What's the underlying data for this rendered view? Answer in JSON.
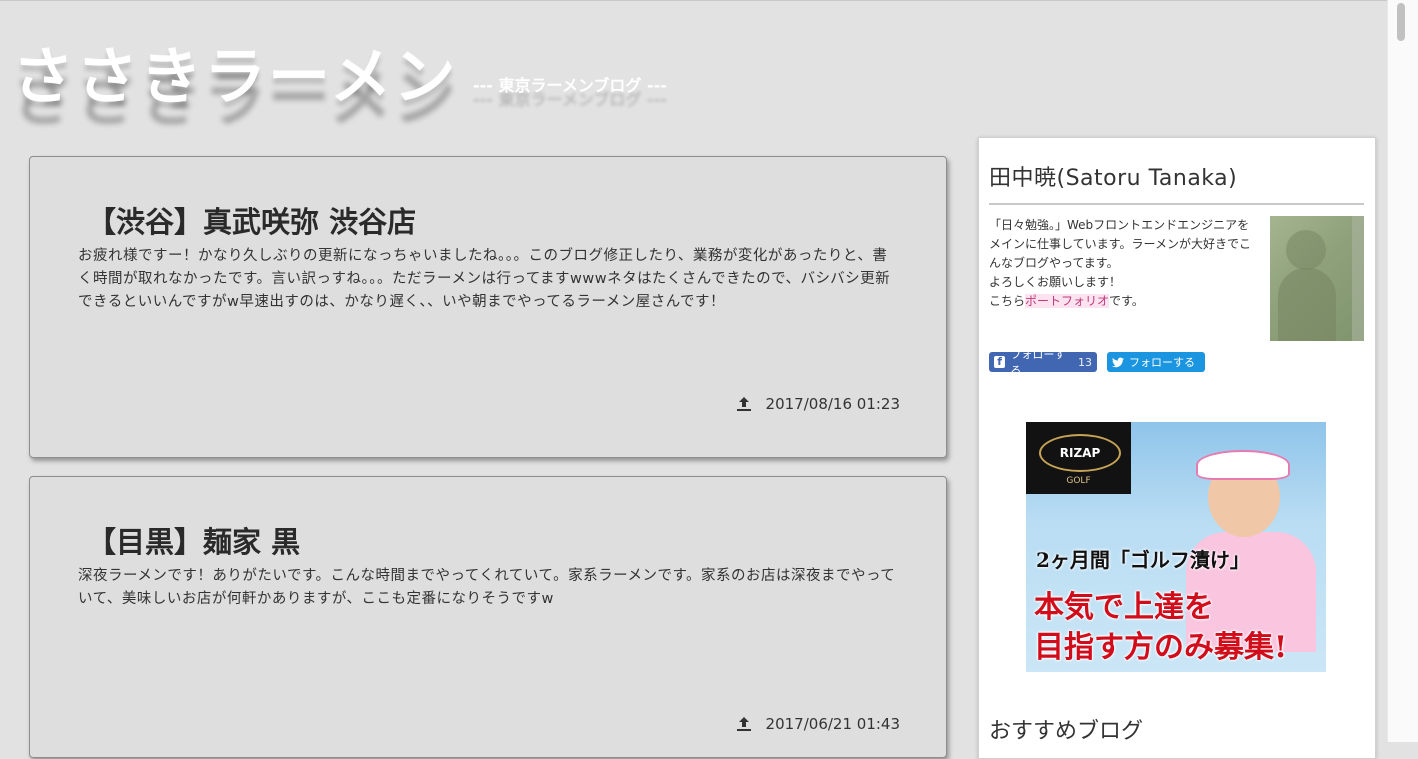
{
  "header": {
    "title": "ささきラーメン",
    "subtitle": "--- 東京ラーメンブログ ---"
  },
  "posts": [
    {
      "title": "【渋谷】真武咲弥 渋谷店",
      "excerpt": "お疲れ様ですー！かなり久しぶりの更新になっちゃいましたね。。。このブログ修正したり、業務が変化があったりと、書く時間が取れなかったです。言い訳っすね。。。ただラーメンは行ってますwwwネタはたくさんできたので、バシバシ更新できるといいんですがw早速出すのは、かなり遅く、、いや朝までやってるラーメン屋さんです！",
      "date": "2017/08/16 01:23"
    },
    {
      "title": "【目黒】麺家 黒",
      "excerpt": "深夜ラーメンです！ありがたいです。こんな時間までやってくれていて。家系ラーメンです。家系のお店は深夜までやっていて、美味しいお店が何軒かありますが、ここも定番になりそうですw",
      "date": "2017/06/21 01:43"
    }
  ],
  "sidebar": {
    "profile_name": "田中暁(Satoru Tanaka)",
    "profile_line1": "「日々勉強。」Webフロントエンドエンジニアをメインに仕事しています。ラーメンが大好きでこんなブログやってます。",
    "profile_line2": "よろしくお願いします！",
    "profile_prefix": "こちら",
    "profile_link": "ポートフォリオ",
    "profile_suffix": "です。",
    "follow_fb_label": "フォローする",
    "follow_fb_count": "13",
    "follow_tw_label": "フォローする",
    "ad": {
      "brand": "RIZAP",
      "sub": "GOLF",
      "line1": "2ヶ月間「ゴルフ漬け」",
      "line2": "本気で上達を",
      "line3": "目指す方のみ募集!"
    },
    "recommend_heading": "おすすめブログ"
  },
  "colors": {
    "background": "#e2e2e2",
    "facebook": "#4267b2",
    "twitter": "#1b95e0",
    "ad_red": "#d10d1b",
    "link_pink": "#fde3f0"
  },
  "icons": {
    "post_date": "upload-icon",
    "facebook": "facebook-icon",
    "twitter": "twitter-icon"
  }
}
